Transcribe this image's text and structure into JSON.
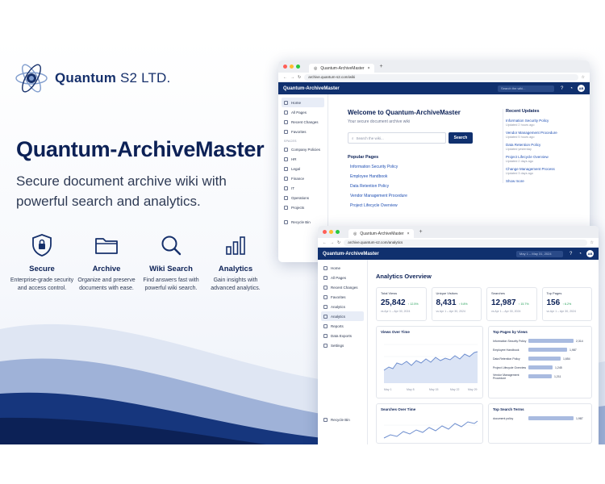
{
  "brand": {
    "name": "Quantum",
    "suffix": "S2 LTD."
  },
  "hero": {
    "title": "Quantum-ArchiveMaster",
    "subtitle": "Secure document archive wiki with powerful search and analytics."
  },
  "features": [
    {
      "title": "Secure",
      "desc": "Enterprise-grade security and access control.",
      "icon": "shield-lock-icon"
    },
    {
      "title": "Archive",
      "desc": "Organize and preserve documents with ease.",
      "icon": "folder-icon"
    },
    {
      "title": "Wiki Search",
      "desc": "Find answers fast with powerful wiki search.",
      "icon": "search-icon"
    },
    {
      "title": "Analytics",
      "desc": "Gain insights with advanced analytics.",
      "icon": "bar-chart-icon"
    }
  ],
  "wiki": {
    "tab": "Quantum-ArchiveMaster",
    "url": "archive.quantum-s2.com/wiki",
    "app_name": "Quantum-ArchiveMaster",
    "search_placeholder": "Search the wiki...",
    "avatar": "AB",
    "sidebar": [
      "Home",
      "All Pages",
      "Recent Changes",
      "Favorites"
    ],
    "spaces_label": "SPACES",
    "spaces": [
      "Company Policies",
      "HR",
      "Legal",
      "Finance",
      "IT",
      "Operations",
      "Projects"
    ],
    "recycle": "Recycle Bin",
    "welcome": "Welcome to Quantum-ArchiveMaster",
    "welcome_sub": "Your secure document archive wiki",
    "main_search_placeholder": "Search the wiki...",
    "search_button": "Search",
    "popular_title": "Popular Pages",
    "popular": [
      "Information Security Policy",
      "Employee Handbook",
      "Data Retention Policy",
      "Vendor Management Procedure",
      "Project Lifecycle Overview"
    ],
    "updates_title": "Recent Updates",
    "updates": [
      {
        "title": "Information Security Policy",
        "date": "Updated 2 hours ago"
      },
      {
        "title": "Vendor Management Procedure",
        "date": "Updated 5 hours ago"
      },
      {
        "title": "Data Retention Policy",
        "date": "Updated yesterday"
      },
      {
        "title": "Project Lifecycle Overview",
        "date": "Updated 2 days ago"
      },
      {
        "title": "Change Management Process",
        "date": "Updated 3 days ago"
      }
    ],
    "show_more": "Show more"
  },
  "analytics": {
    "tab": "Quantum-ArchiveMaster",
    "url": "archive.quantum-s2.com/analytics",
    "app_name": "Quantum-ArchiveMaster",
    "date_range": "May 1 – May 31, 2024",
    "avatar": "AB",
    "sidebar": [
      "Home",
      "All Pages",
      "Recent Changes",
      "Favorites",
      "Analytics",
      "Analytics",
      "Reports",
      "Data Exports",
      "Settings"
    ],
    "recycle": "Recycle Bin",
    "title": "Analytics Overview",
    "kpis": [
      {
        "label": "Total Views",
        "value": "25,842",
        "delta": "↑ 12.5%",
        "compare": "vs Apr 1 – Apr 30, 2024"
      },
      {
        "label": "Unique Visitors",
        "value": "8,431",
        "delta": "↑ 9.8%",
        "compare": "vs Apr 1 – Apr 30, 2024"
      },
      {
        "label": "Searches",
        "value": "12,987",
        "delta": "↑ 15.7%",
        "compare": "vs Apr 1 – Apr 30, 2024"
      },
      {
        "label": "Top Pages",
        "value": "156",
        "delta": "↑ 6.2%",
        "compare": "vs Apr 1 – Apr 30, 2024"
      }
    ],
    "views_title": "Views Over Time",
    "views_xlabels": [
      "May 1",
      "May 8",
      "May 15",
      "May 22",
      "May 29"
    ],
    "top_pages_title": "Top Pages by Views",
    "top_pages": [
      {
        "label": "Information Security Policy",
        "value": "2,314",
        "ratio": 1.0
      },
      {
        "label": "Employee Handbook",
        "value": "1,987",
        "ratio": 0.86
      },
      {
        "label": "Data Retention Policy",
        "value": "1,654",
        "ratio": 0.71
      },
      {
        "label": "Project Lifecycle Overview",
        "value": "1,245",
        "ratio": 0.54
      },
      {
        "label": "Vendor Management Procedure",
        "value": "1,211",
        "ratio": 0.52
      }
    ],
    "searches_title": "Searches Over Time",
    "search_terms_title": "Top Search Terms",
    "search_terms": [
      {
        "label": "document policy",
        "value": "1,987",
        "ratio": 1.0
      }
    ]
  },
  "colors": {
    "navy": "#10306e",
    "accent": "#1f4fb3",
    "bar": "#a9bbe0"
  }
}
